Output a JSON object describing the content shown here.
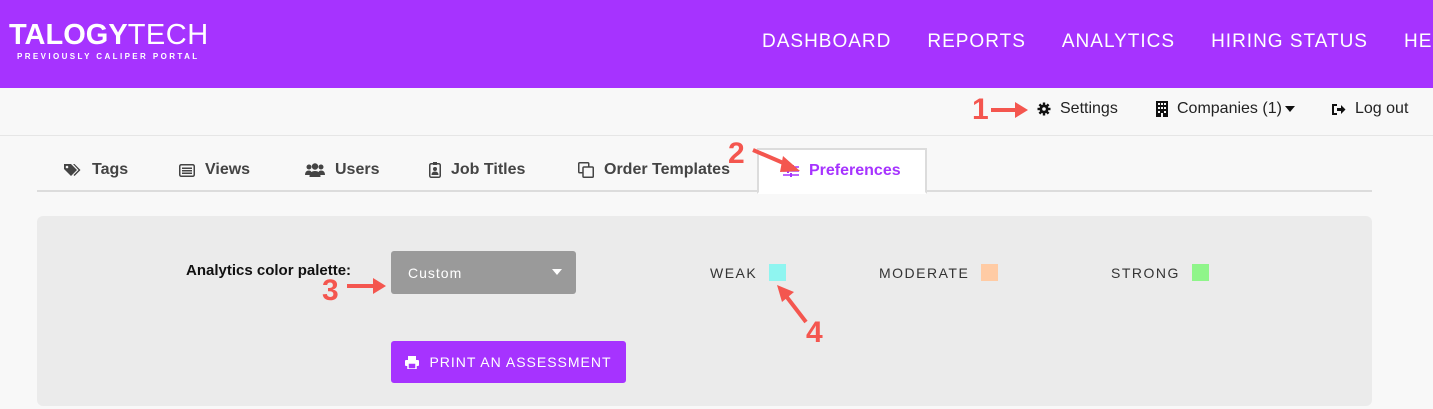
{
  "brand": {
    "name_bold": "TALOGY",
    "name_light": "TECH",
    "tagline": "PREVIOUSLY CALIPER PORTAL"
  },
  "main_nav": [
    "DASHBOARD",
    "REPORTS",
    "ANALYTICS",
    "HIRING STATUS",
    "HELP"
  ],
  "util_nav": {
    "settings": "Settings",
    "companies": "Companies (1)",
    "logout": "Log out"
  },
  "tabs": [
    "Tags",
    "Views",
    "Users",
    "Job Titles",
    "Order Templates",
    "Preferences"
  ],
  "active_tab": "Preferences",
  "preferences": {
    "palette_label": "Analytics color palette:",
    "palette_selected": "Custom",
    "legend": [
      {
        "label": "WEAK",
        "color": "#8ff5f0"
      },
      {
        "label": "MODERATE",
        "color": "#ffcba4"
      },
      {
        "label": "STRONG",
        "color": "#8ff58a"
      }
    ],
    "print_button": "PRINT AN ASSESSMENT"
  },
  "annotations": [
    "1",
    "2",
    "3",
    "4"
  ],
  "colors": {
    "brand": "#a633ff",
    "annotation": "#f4564f"
  }
}
